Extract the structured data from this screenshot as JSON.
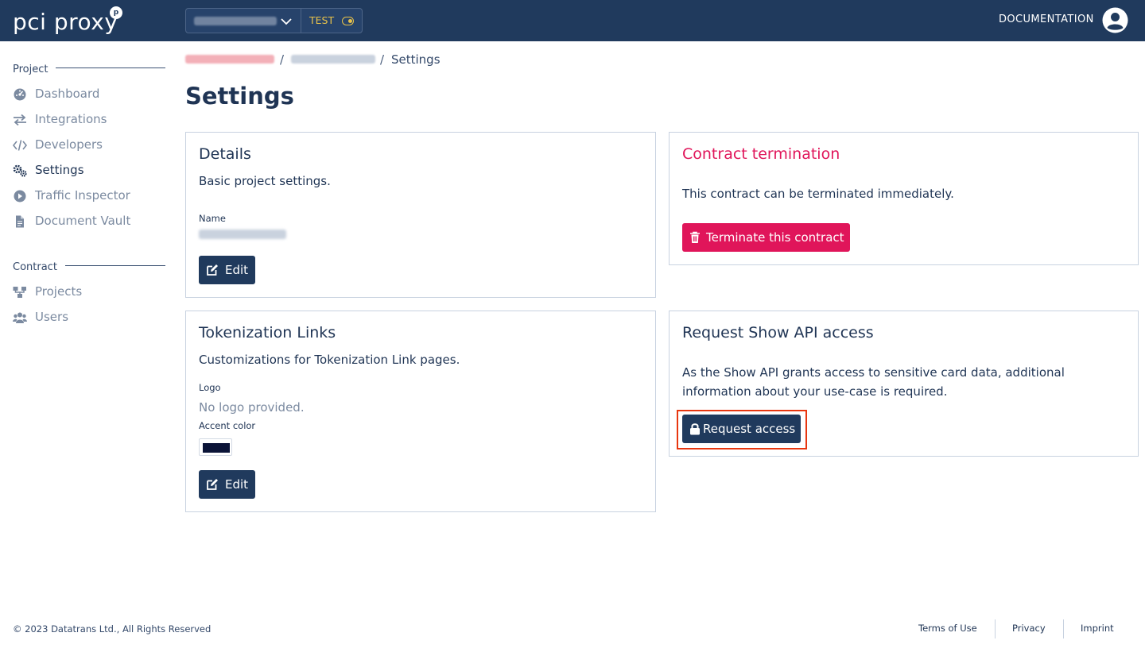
{
  "header": {
    "logo_text": "pci proxy",
    "logo_badge": "p",
    "environment": "TEST",
    "documentation_label": "DOCUMENTATION"
  },
  "sidebar": {
    "sections": [
      {
        "title": "Project",
        "items": [
          {
            "label": "Dashboard",
            "icon": "dashboard-icon"
          },
          {
            "label": "Integrations",
            "icon": "arrows-exchange-icon"
          },
          {
            "label": "Developers",
            "icon": "code-icon"
          },
          {
            "label": "Settings",
            "icon": "gears-icon",
            "active": true
          },
          {
            "label": "Traffic Inspector",
            "icon": "play-circle-icon"
          },
          {
            "label": "Document Vault",
            "icon": "file-icon"
          }
        ]
      },
      {
        "title": "Contract",
        "items": [
          {
            "label": "Projects",
            "icon": "sitemap-icon"
          },
          {
            "label": "Users",
            "icon": "users-icon"
          }
        ]
      }
    ]
  },
  "breadcrumb": {
    "separator": "/",
    "current": "Settings"
  },
  "page_title": "Settings",
  "details_card": {
    "title": "Details",
    "description": "Basic project settings.",
    "name_label": "Name",
    "edit_label": "Edit"
  },
  "tokenization_card": {
    "title": "Tokenization Links",
    "description": "Customizations for Tokenization Link pages.",
    "logo_label": "Logo",
    "logo_value": "No logo provided.",
    "accent_label": "Accent color",
    "accent_color": "#0b1437",
    "edit_label": "Edit"
  },
  "contract_card": {
    "title": "Contract termination",
    "description": "This contract can be terminated immediately.",
    "terminate_label": "Terminate this contract"
  },
  "show_api_card": {
    "title": "Request Show API access",
    "description": "As the Show API grants access to sensitive card data, additional information about your use-case is required.",
    "request_label": "Request access"
  },
  "footer": {
    "copyright": "© 2023 Datatrans Ltd., All Rights Reserved",
    "links": [
      "Terms of Use",
      "Privacy",
      "Imprint"
    ]
  },
  "colors": {
    "header_bg": "#203a5d",
    "primary": "#203a5d",
    "danger": "#e0155a",
    "test_badge": "#e8c24a",
    "highlight": "#e8360f"
  }
}
